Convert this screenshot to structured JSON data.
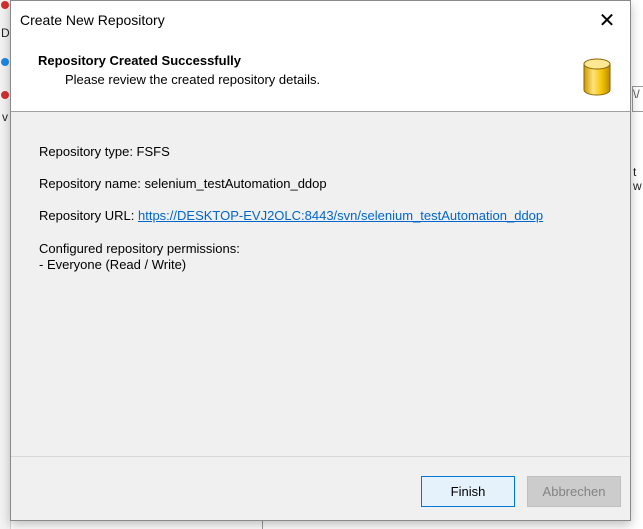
{
  "background": {
    "fragment_d": "D",
    "fragment_v": "v",
    "fragment_w": "t w",
    "fragment_field": "\\/"
  },
  "dialog": {
    "title": "Create New Repository",
    "close_symbol": "✕",
    "header": {
      "title": "Repository Created Successfully",
      "subtitle": "Please review the created repository details.",
      "icon": "database-icon"
    },
    "details": {
      "type_line": "Repository type: FSFS",
      "name_line": "Repository name: selenium_testAutomation_ddop",
      "url_label": "Repository URL: ",
      "url_value": "https://DESKTOP-EVJ2OLC:8443/svn/selenium_testAutomation_ddop",
      "permissions_heading": "Configured repository permissions:",
      "permissions_item": "- Everyone (Read / Write)"
    },
    "buttons": {
      "finish_label": "Finish",
      "cancel_label": "Abbrechen"
    }
  },
  "colors": {
    "link": "#0066cc",
    "primary_border": "#0078d7",
    "icon_gold": "#f2c200"
  }
}
